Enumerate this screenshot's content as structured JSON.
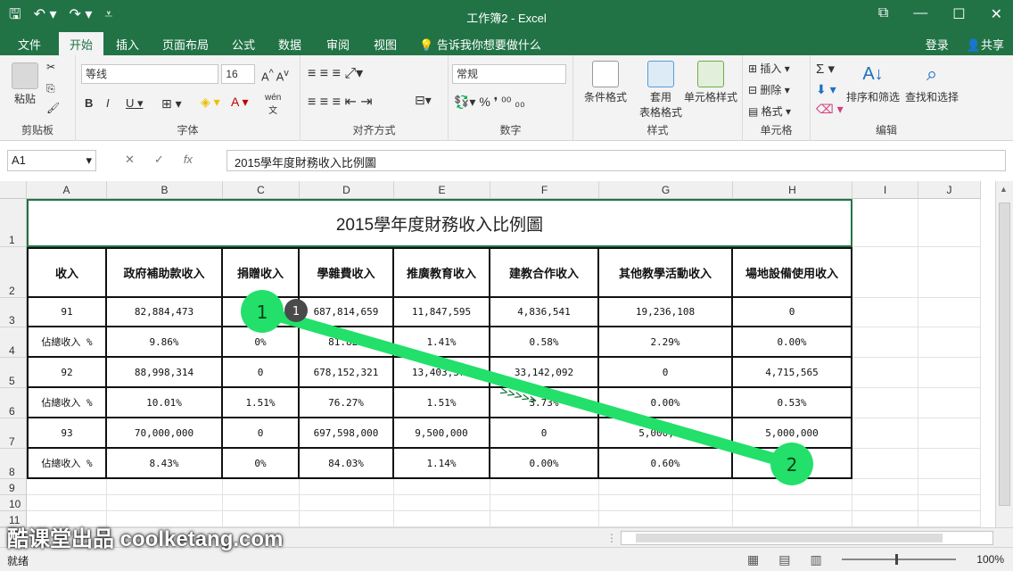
{
  "window": {
    "title": "工作簿2 - Excel"
  },
  "tabs": [
    "文件",
    "开始",
    "插入",
    "页面布局",
    "公式",
    "数据",
    "审阅",
    "视图"
  ],
  "active_tab": "开始",
  "tell_me": "告诉我你想要做什么",
  "login": "登录",
  "share": "共享",
  "ribbon": {
    "paste": "粘贴",
    "clipboard": "剪贴板",
    "font_name": "等线",
    "font_size": "16",
    "font_group": "字体",
    "align_group": "对齐方式",
    "number_format": "常规",
    "number_group": "数字",
    "cond_format": "条件格式",
    "table_format_1": "套用",
    "table_format_2": "表格格式",
    "cell_style": "单元格样式",
    "style_group": "样式",
    "insert": "插入",
    "delete": "删除",
    "format": "格式",
    "cells_group": "单元格",
    "sort_filter": "排序和筛选",
    "find_select": "查找和选择",
    "edit_group": "编辑",
    "wen": "wén"
  },
  "formula_bar": {
    "name_box": "A1",
    "fx": "fx",
    "content": "2015學年度財務收入比例圖"
  },
  "columns": [
    "A",
    "B",
    "C",
    "D",
    "E",
    "F",
    "G",
    "H",
    "I",
    "J"
  ],
  "rows": [
    "1",
    "2",
    "3",
    "4",
    "5",
    "6",
    "7",
    "8",
    "9",
    "10",
    "11"
  ],
  "sheet_title": "2015學年度財務收入比例圖",
  "headers": [
    "收入",
    "政府補助款收入",
    "捐贈收入",
    "學雜費收入",
    "推廣教育收入",
    "建教合作收入",
    "其他教學活動收入",
    "場地設備使用收入"
  ],
  "table": [
    [
      "91",
      "82,884,473",
      "0",
      "687,814,659",
      "11,847,595",
      "4,836,541",
      "19,236,108",
      "0"
    ],
    [
      "佔總收入 %",
      "9.86%",
      "0%",
      "81.82%",
      "1.41%",
      "0.58%",
      "2.29%",
      "0.00%"
    ],
    [
      "92",
      "88,998,314",
      "0",
      "678,152,321",
      "13,403,370",
      "33,142,092",
      "0",
      "4,715,565"
    ],
    [
      "佔總收入 %",
      "10.01%",
      "1.51%",
      "76.27%",
      "1.51%",
      "3.73%",
      "0.00%",
      "0.53%"
    ],
    [
      "93",
      "70,000,000",
      "0",
      "697,598,000",
      "9,500,000",
      "0",
      "5,000,000",
      "5,000,000"
    ],
    [
      "佔總收入 %",
      "8.43%",
      "0%",
      "84.03%",
      "1.14%",
      "0.00%",
      "0.60%",
      "0.00%"
    ]
  ],
  "markers": {
    "start": "1",
    "small": "1",
    "end": "2",
    "arrows": ">>>>>"
  },
  "status": {
    "ready": "就绪",
    "zoom": "100%"
  },
  "watermark": "酷课堂出品 coolketang.com",
  "colors": {
    "excel_green": "#217346",
    "marker_green": "#22e06a"
  }
}
